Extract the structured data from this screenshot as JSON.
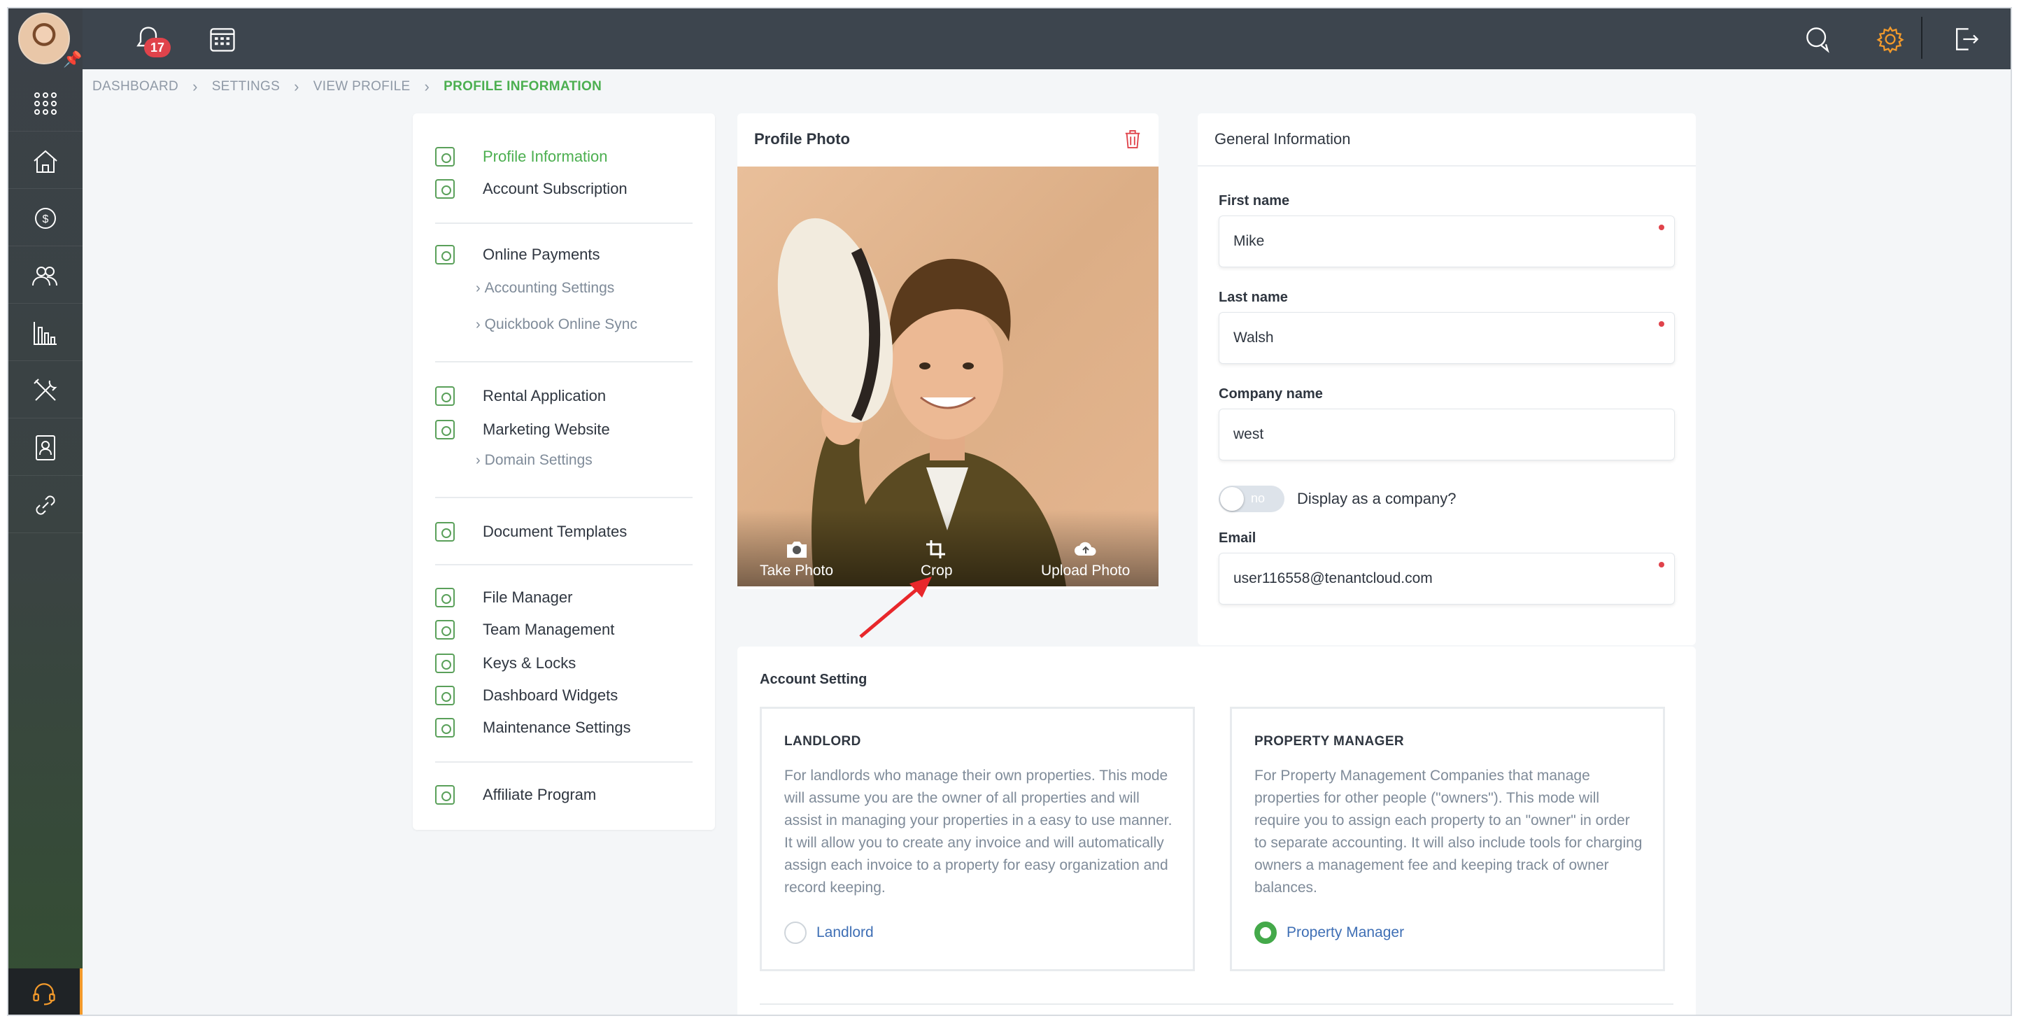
{
  "topbar": {
    "notification_count": "17"
  },
  "breadcrumb": [
    "DASHBOARD",
    "SETTINGS",
    "VIEW PROFILE",
    "PROFILE INFORMATION"
  ],
  "settings_nav": {
    "items": [
      {
        "label": "Profile Information"
      },
      {
        "label": "Account Subscription"
      },
      {
        "label": "Online Payments"
      },
      {
        "label": "Accounting Settings"
      },
      {
        "label": "Quickbook Online Sync"
      },
      {
        "label": "Rental Application"
      },
      {
        "label": "Marketing Website"
      },
      {
        "label": "Domain Settings"
      },
      {
        "label": "Document Templates"
      },
      {
        "label": "File Manager"
      },
      {
        "label": "Team Management"
      },
      {
        "label": "Keys & Locks"
      },
      {
        "label": "Dashboard Widgets"
      },
      {
        "label": "Maintenance Settings"
      },
      {
        "label": "Affiliate Program"
      }
    ]
  },
  "profile_photo": {
    "title": "Profile Photo",
    "actions": {
      "take": "Take Photo",
      "crop": "Crop",
      "upload": "Upload Photo"
    }
  },
  "general_info": {
    "title": "General Information",
    "first_name_label": "First name",
    "first_name_value": "Mike",
    "last_name_label": "Last name",
    "last_name_value": "Walsh",
    "company_label": "Company name",
    "company_value": "west",
    "toggle_state": "no",
    "toggle_label": "Display as a company?",
    "email_label": "Email",
    "email_value": "user116558@tenantcloud.com"
  },
  "account_setting": {
    "title": "Account Setting",
    "landlord": {
      "heading": "LANDLORD",
      "description": "For landlords who manage their own properties. This mode will assume you are the owner of all properties and will assist in managing your properties in a easy to use manner. It will allow you to create any invoice and will automatically assign each invoice to a property for easy organization and record keeping.",
      "option": "Landlord",
      "selected": false
    },
    "manager": {
      "heading": "PROPERTY MANAGER",
      "description": "For Property Management Companies that manage properties for other people (\"owners\"). This mode will require you to assign each property to an \"owner\" in order to separate accounting. It will also include tools for charging owners a management fee and keeping track of owner balances.",
      "option": "Property Manager",
      "selected": true
    }
  },
  "colors": {
    "accent_green": "#4caf50",
    "topbar": "#3d454e",
    "badge_red": "#e0434b",
    "link_blue": "#3f6fb5",
    "settings_orange": "#f39a2b"
  }
}
